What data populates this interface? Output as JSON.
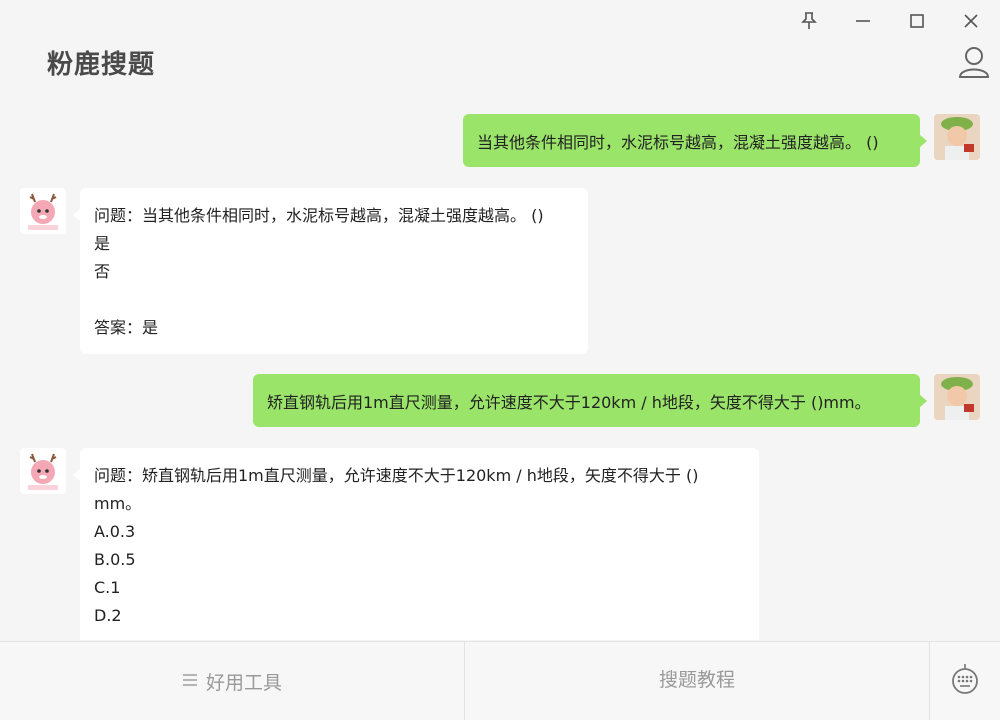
{
  "app": {
    "title": "粉鹿搜题"
  },
  "window_controls": [
    "pin-icon",
    "minimize-icon",
    "maximize-icon",
    "close-icon"
  ],
  "messages": [
    {
      "from": "user",
      "text": "当其他条件相同时，水泥标号越高，混凝土强度越高。 ()"
    },
    {
      "from": "bot",
      "lines": [
        "问题：当其他条件相同时，水泥标号越高，混凝土强度越高。 ()",
        "是",
        "否",
        "",
        "答案：是"
      ]
    },
    {
      "from": "user",
      "text": "矫直钢轨后用1m直尺测量，允许速度不大于120km / h地段，矢度不得大于 ()mm。"
    },
    {
      "from": "bot",
      "lines": [
        "问题：矫直钢轨后用1m直尺测量，允许速度不大于120km / h地段，矢度不得大于 ()",
        "mm。",
        "A.0.3",
        "B.0.5",
        "C.1",
        "D.2"
      ]
    }
  ],
  "bottom_bar": {
    "tools_label": "好用工具",
    "tutorial_label": "搜题教程"
  },
  "colors": {
    "user_bubble": "#9be46a",
    "bot_bubble": "#ffffff",
    "background": "#f5f5f5"
  }
}
